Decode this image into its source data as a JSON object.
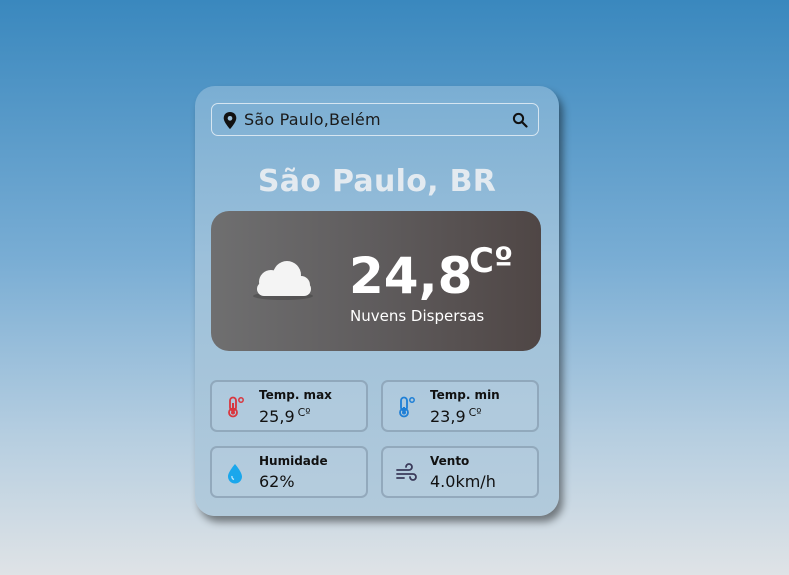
{
  "search": {
    "value": "São Paulo,Belém",
    "icon": "search-icon",
    "location_icon": "location-pin-icon"
  },
  "city": "São Paulo, BR",
  "current": {
    "temperature": "24,8",
    "unit": "Cº",
    "description": "Nuvens Dispersas",
    "icon": "cloud-icon"
  },
  "stats": {
    "temp_max": {
      "label": "Temp. max",
      "value": "25,9",
      "unit": "Cº",
      "icon": "thermometer-hot-icon",
      "color": "#d9363e"
    },
    "temp_min": {
      "label": "Temp. min",
      "value": "23,9",
      "unit": "Cº",
      "icon": "thermometer-cold-icon",
      "color": "#1e7fd6"
    },
    "humidity": {
      "label": "Humidade",
      "value": "62%",
      "icon": "water-drop-icon",
      "color": "#1aa7ec"
    },
    "wind": {
      "label": "Vento",
      "value": "4.0km/h",
      "icon": "wind-icon",
      "color": "#3a3a5a"
    }
  },
  "colors": {
    "background_top": "#3a88be",
    "background_bottom": "#dfe3e6",
    "weather_box": "#5f5c5d",
    "city_text": "#e3eaf0"
  }
}
